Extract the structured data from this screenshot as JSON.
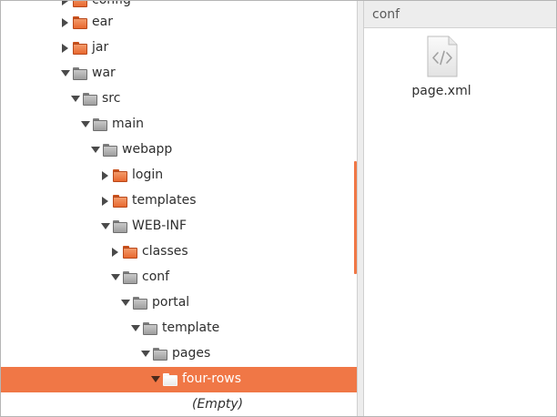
{
  "tree": {
    "rows": [
      {
        "label": "config",
        "state": "collapsed",
        "folder_color": "orange"
      },
      {
        "label": "ear",
        "state": "collapsed",
        "folder_color": "orange"
      },
      {
        "label": "jar",
        "state": "collapsed",
        "folder_color": "orange"
      },
      {
        "label": "war",
        "state": "expanded",
        "folder_color": "grey"
      },
      {
        "label": "src",
        "state": "expanded",
        "folder_color": "grey"
      },
      {
        "label": "main",
        "state": "expanded",
        "folder_color": "grey"
      },
      {
        "label": "webapp",
        "state": "expanded",
        "folder_color": "grey"
      },
      {
        "label": "login",
        "state": "collapsed",
        "folder_color": "orange"
      },
      {
        "label": "templates",
        "state": "collapsed",
        "folder_color": "orange"
      },
      {
        "label": "WEB-INF",
        "state": "expanded",
        "folder_color": "grey"
      },
      {
        "label": "classes",
        "state": "collapsed",
        "folder_color": "orange"
      },
      {
        "label": "conf",
        "state": "expanded",
        "folder_color": "grey"
      },
      {
        "label": "portal",
        "state": "expanded",
        "folder_color": "grey"
      },
      {
        "label": "template",
        "state": "expanded",
        "folder_color": "grey"
      },
      {
        "label": "pages",
        "state": "expanded",
        "folder_color": "grey"
      },
      {
        "label": "four-rows",
        "state": "expanded",
        "folder_color": "white",
        "selected": true
      }
    ],
    "empty_placeholder": "(Empty)"
  },
  "right_pane": {
    "location_label": "conf",
    "files": [
      {
        "name": "page.xml",
        "icon": "xml-file-icon"
      }
    ]
  },
  "colors": {
    "selection": "#f07746",
    "folder_orange": "#e8692f",
    "folder_grey": "#9e9e9e"
  }
}
